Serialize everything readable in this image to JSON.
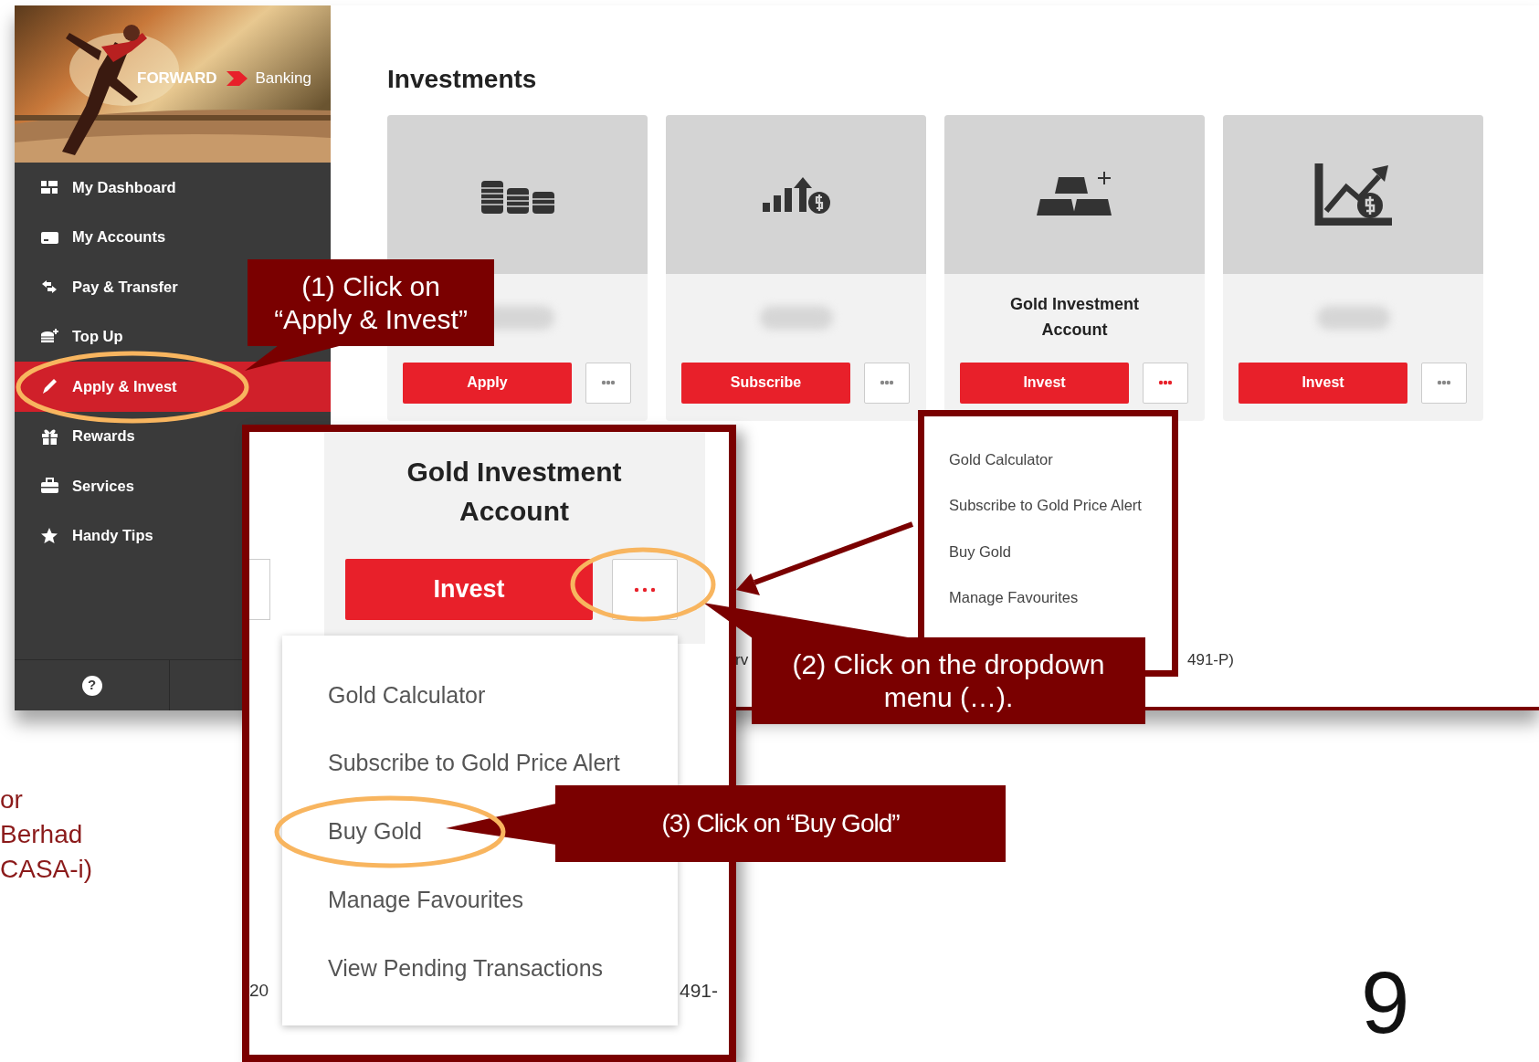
{
  "sidebar": {
    "brand": {
      "first": "FORWARD",
      "second": "Banking"
    },
    "items": [
      {
        "label": "My Dashboard",
        "selected": false
      },
      {
        "label": "My Accounts",
        "selected": false
      },
      {
        "label": "Pay & Transfer",
        "selected": false
      },
      {
        "label": "Top Up",
        "selected": false
      },
      {
        "label": "Apply & Invest",
        "selected": true
      },
      {
        "label": "Rewards",
        "selected": false
      },
      {
        "label": "Services",
        "selected": false
      },
      {
        "label": "Handy Tips",
        "selected": false
      }
    ],
    "help": "?"
  },
  "main": {
    "title": "Investments",
    "cards": [
      {
        "action": "Apply",
        "menu_open": false
      },
      {
        "action": "Subscribe",
        "menu_open": false
      },
      {
        "title": "Gold Investment Account",
        "action": "Invest",
        "menu_open": true
      },
      {
        "action": "Invest",
        "menu_open": false
      }
    ],
    "dropdown": [
      "Gold Calculator",
      "Subscribe to Gold Price Alert",
      "Buy Gold",
      "Manage Favourites"
    ],
    "fragments": [
      "rv",
      "491-P)"
    ]
  },
  "inset": {
    "title": "Gold Investment Account",
    "action": "Invest",
    "menu_open": true,
    "menu": [
      "Gold Calculator",
      "Subscribe to Gold Price Alert",
      "Buy Gold",
      "Manage Favourites",
      "View Pending Transactions"
    ],
    "fragments": [
      "20",
      "491-"
    ]
  },
  "callouts": [
    "(1) Click on\n“Apply & Invest”",
    "(2) Click on the dropdown\nmenu (…).",
    "(3) Click on “Buy Gold”"
  ],
  "slide": {
    "side_text": [
      "or",
      "Berhad",
      "CASA-i)"
    ],
    "page_number": "9"
  }
}
